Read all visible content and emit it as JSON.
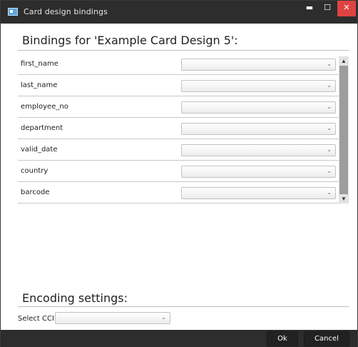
{
  "window": {
    "title": "Card design bindings",
    "controls": {
      "minimize": "▬",
      "maximize": "☐",
      "close": "✕"
    }
  },
  "bindings": {
    "heading": "Bindings for 'Example Card Design 5':",
    "rows": [
      {
        "label": "first_name",
        "value": ""
      },
      {
        "label": "last_name",
        "value": ""
      },
      {
        "label": "employee_no",
        "value": ""
      },
      {
        "label": "department",
        "value": ""
      },
      {
        "label": "valid_date",
        "value": ""
      },
      {
        "label": "country",
        "value": ""
      },
      {
        "label": "barcode",
        "value": ""
      }
    ],
    "dropdown_glyph": "⌄"
  },
  "encoding": {
    "heading": "Encoding settings:",
    "select_cci_label": "Select CCI:",
    "select_cci_value": ""
  },
  "buttons": {
    "ok": "Ok",
    "cancel": "Cancel"
  },
  "icons": {
    "app": "card-app-icon",
    "dropdown": "chevron-down-icon",
    "scroll_up": "scroll-up-arrow-icon",
    "scroll_down": "scroll-down-arrow-icon"
  },
  "colors": {
    "titlebar": "#2d2d2d",
    "close": "#e04343",
    "app_icon": "#5aa3dd"
  }
}
